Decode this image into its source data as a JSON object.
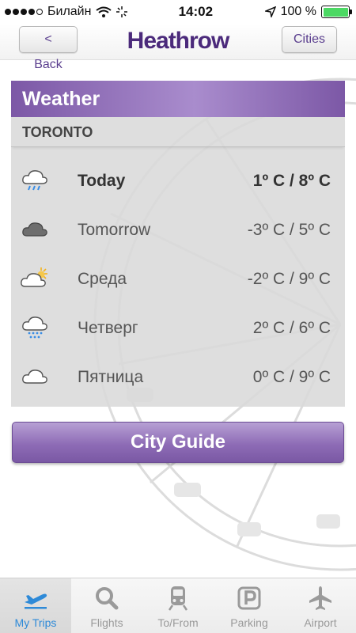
{
  "status_bar": {
    "carrier": "Билайн",
    "time": "14:02",
    "battery": "100 %"
  },
  "nav": {
    "back_label": "< Back",
    "logo": "Heathrow",
    "cities_label": "Cities"
  },
  "weather": {
    "title": "Weather",
    "city": "TORONTO",
    "forecast": [
      {
        "day": "Today",
        "temp": "1º C / 8º C",
        "icon": "rain-cloud-icon"
      },
      {
        "day": "Tomorrow",
        "temp": "-3º C / 5º C",
        "icon": "dark-cloud-icon"
      },
      {
        "day": "Среда",
        "temp": "-2º C / 9º C",
        "icon": "sun-cloud-icon"
      },
      {
        "day": "Четверг",
        "temp": "2º C / 6º C",
        "icon": "snow-cloud-icon"
      },
      {
        "day": "Пятница",
        "temp": "0º C / 9º C",
        "icon": "cloud-icon"
      }
    ]
  },
  "city_guide_label": "City Guide",
  "tabs": [
    {
      "label": "My Trips",
      "icon": "airplane-takeoff-icon",
      "active": true
    },
    {
      "label": "Flights",
      "icon": "search-icon",
      "active": false
    },
    {
      "label": "To/From",
      "icon": "train-icon",
      "active": false
    },
    {
      "label": "Parking",
      "icon": "parking-icon",
      "active": false
    },
    {
      "label": "Airport",
      "icon": "airplane-icon",
      "active": false
    }
  ],
  "colors": {
    "brand_purple": "#4b2a7b",
    "header_purple": "#8a68b4",
    "active_tab_blue": "#2e8ad8",
    "battery_green": "#4cd964"
  }
}
